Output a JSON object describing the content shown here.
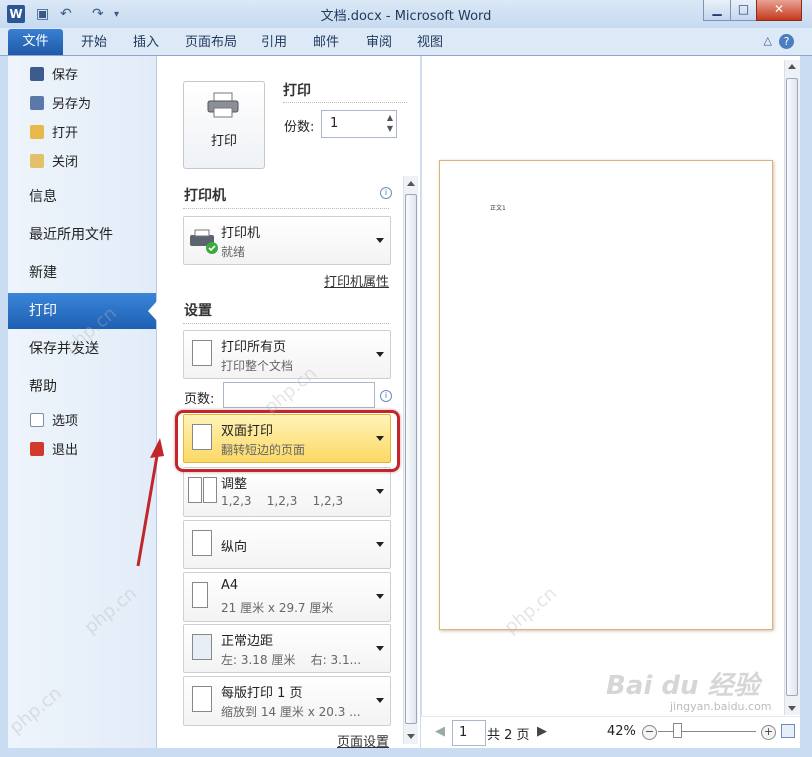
{
  "window": {
    "title": "文档.docx - Microsoft Word",
    "app_icon": "W",
    "controls": [
      "minimize-icon",
      "maximize-icon",
      "close-icon"
    ]
  },
  "ribbon": {
    "file_tab": "文件",
    "tabs": [
      "开始",
      "插入",
      "页面布局",
      "引用",
      "邮件",
      "审阅",
      "视图"
    ],
    "help": "?"
  },
  "nav": {
    "small_top": [
      "保存",
      "另存为",
      "打开",
      "关闭"
    ],
    "large": [
      "信息",
      "最近所用文件",
      "新建",
      "打印",
      "保存并发送",
      "帮助"
    ],
    "small_bottom": [
      "选项",
      "退出"
    ],
    "selected": "打印"
  },
  "print": {
    "heading": "打印",
    "button_label": "打印",
    "copies_label": "份数:",
    "copies_value": "1"
  },
  "printer": {
    "heading": "打印机",
    "name": "打印机",
    "status": "就绪",
    "properties_link": "打印机属性"
  },
  "settings": {
    "heading": "设置",
    "print_range": {
      "title": "打印所有页",
      "subtitle": "打印整个文档"
    },
    "pages_label": "页数:",
    "duplex": {
      "title": "双面打印",
      "subtitle": "翻转短边的页面"
    },
    "collate": {
      "title": "调整",
      "subtitle": "1,2,3    1,2,3    1,2,3"
    },
    "orientation": {
      "title": "纵向"
    },
    "paper": {
      "title": "A4",
      "subtitle": "21 厘米 x 29.7 厘米"
    },
    "margins": {
      "title": "正常边距",
      "subtitle": "左: 3.18 厘米    右: 3.1..."
    },
    "per_page": {
      "title": "每版打印 1 页",
      "subtitle": "缩放到 14 厘米 x 20.3 ..."
    },
    "page_setup_link": "页面设置"
  },
  "preview": {
    "page_text": "正文1",
    "current_page": "1",
    "total_pages": "共 2 页",
    "zoom": "42%"
  },
  "watermarks": [
    "php.cn",
    "php.cn",
    "php.cn",
    "php.cn",
    "php.cn"
  ],
  "baidu_logo": "Bai du 经验",
  "baidu_url": "jingyan.baidu.com",
  "colors": {
    "accent": "#1e5fb3",
    "highlight": "#fcd966",
    "annotation": "#c0262c"
  }
}
